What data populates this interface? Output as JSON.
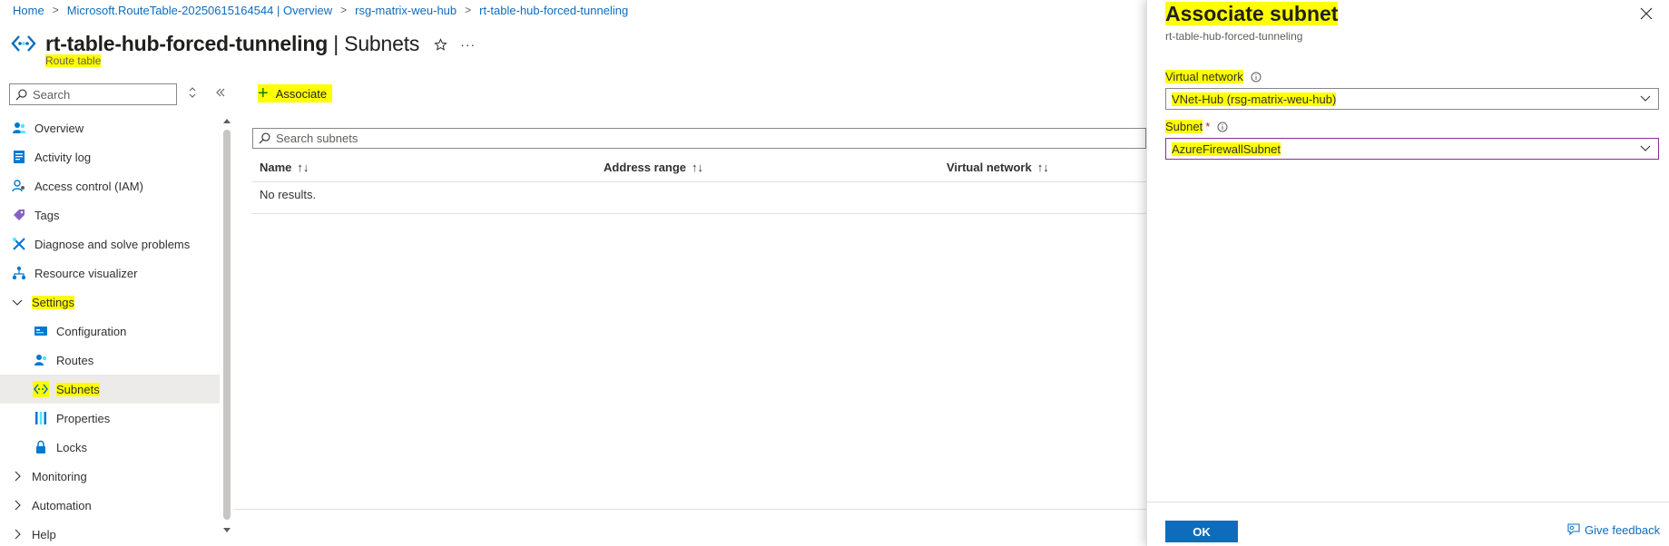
{
  "breadcrumb": [
    "Home",
    "Microsoft.RouteTable-20250615164544 | Overview",
    "rsg-matrix-weu-hub",
    "rt-table-hub-forced-tunneling"
  ],
  "header": {
    "title": "rt-table-hub-forced-tunneling",
    "title_sep": " | ",
    "section": "Subnets",
    "subtitle": "Route table",
    "favorite_icon": "star-icon",
    "more_icon": "more-icon"
  },
  "sidebar": {
    "search_placeholder": "Search",
    "items": [
      {
        "label": "Overview",
        "icon": "overview-icon",
        "level": 0
      },
      {
        "label": "Activity log",
        "icon": "activity-log-icon",
        "level": 0
      },
      {
        "label": "Access control (IAM)",
        "icon": "iam-icon",
        "level": 0
      },
      {
        "label": "Tags",
        "icon": "tag-icon",
        "level": 0
      },
      {
        "label": "Diagnose and solve problems",
        "icon": "diagnose-icon",
        "level": 0
      },
      {
        "label": "Resource visualizer",
        "icon": "visualizer-icon",
        "level": 0
      },
      {
        "label": "Settings",
        "icon": "chevron-down-icon",
        "level": "group",
        "expanded": true
      },
      {
        "label": "Configuration",
        "icon": "configuration-icon",
        "level": 1
      },
      {
        "label": "Routes",
        "icon": "routes-icon",
        "level": 1
      },
      {
        "label": "Subnets",
        "icon": "subnets-icon",
        "level": 1,
        "active": true
      },
      {
        "label": "Properties",
        "icon": "properties-icon",
        "level": 1
      },
      {
        "label": "Locks",
        "icon": "lock-icon",
        "level": 1
      },
      {
        "label": "Monitoring",
        "icon": "chevron-right-icon",
        "level": "group",
        "expanded": false
      },
      {
        "label": "Automation",
        "icon": "chevron-right-icon",
        "level": "group",
        "expanded": false
      },
      {
        "label": "Help",
        "icon": "chevron-right-icon",
        "level": "group",
        "expanded": false
      }
    ]
  },
  "main": {
    "associate_label": "Associate",
    "search_placeholder": "Search subnets",
    "columns": [
      "Name",
      "Address range",
      "Virtual network"
    ],
    "sort_glyph": "↑↓",
    "empty_text": "No results."
  },
  "panel": {
    "title": "Associate subnet",
    "subtitle": "rt-table-hub-forced-tunneling",
    "vnet_label": "Virtual network",
    "vnet_value": "VNet-Hub (rsg-matrix-weu-hub)",
    "subnet_label": "Subnet",
    "subnet_required": "*",
    "subnet_value": "AzureFirewallSubnet",
    "ok_label": "OK",
    "feedback_label": "Give feedback"
  },
  "colors": {
    "accent": "#0f6cbd",
    "highlight": "#ffff00",
    "focus_border": "#8a2e94"
  }
}
